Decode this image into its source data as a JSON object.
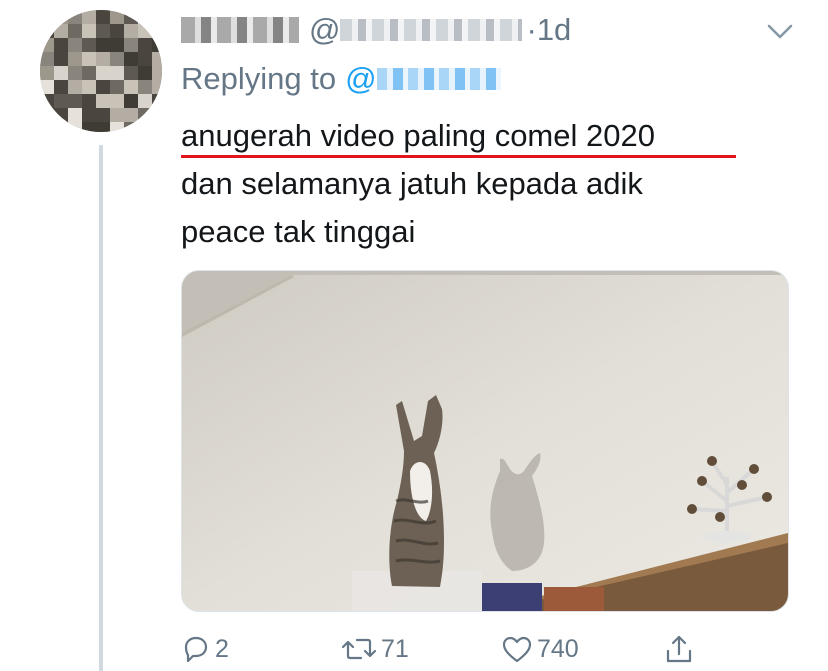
{
  "tweet": {
    "author_name": "",
    "author_handle_prefix": "@",
    "separator": "·",
    "time": "1d",
    "replying_label": "Replying to",
    "replying_at": "@",
    "body_lines": [
      "anugerah video paling comel 2020",
      "dan selamanya jatuh kepada adik",
      "peace tak tinggai"
    ],
    "actions": {
      "reply_count": "2",
      "retweet_count": "71",
      "like_count": "740"
    }
  },
  "colors": {
    "accent": "#1da1f2",
    "muted_text": "#657786",
    "primary_text": "#14171a",
    "highlight_underline": "#e0141e",
    "thread_line": "#cfd9de"
  },
  "icons": {
    "caret": "chevron-down-icon",
    "reply": "reply-icon",
    "retweet": "retweet-icon",
    "like": "heart-icon",
    "share": "share-icon"
  }
}
